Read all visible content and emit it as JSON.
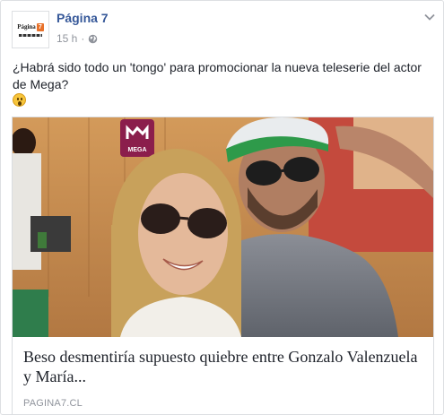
{
  "post": {
    "page_name": "Página 7",
    "time": "15 h",
    "separator": "·",
    "text": "¿Habrá sido todo un 'tongo' para promocionar la nueva teleserie del actor de Mega?",
    "avatar_logo_text": "Página",
    "avatar_logo_box": "7"
  },
  "link": {
    "mega_logo_text": "MEGA",
    "title": "Beso desmentiría supuesto quiebre entre Gonzalo Valenzuela y María...",
    "domain": "PAGINA7.CL"
  },
  "icons": {
    "globe": "globe-icon",
    "options": "chevron-down-icon",
    "emoji": "surprised-face-emoji-icon"
  },
  "colors": {
    "page_name": "#365899",
    "meta": "#90949c",
    "text": "#1d2129"
  }
}
